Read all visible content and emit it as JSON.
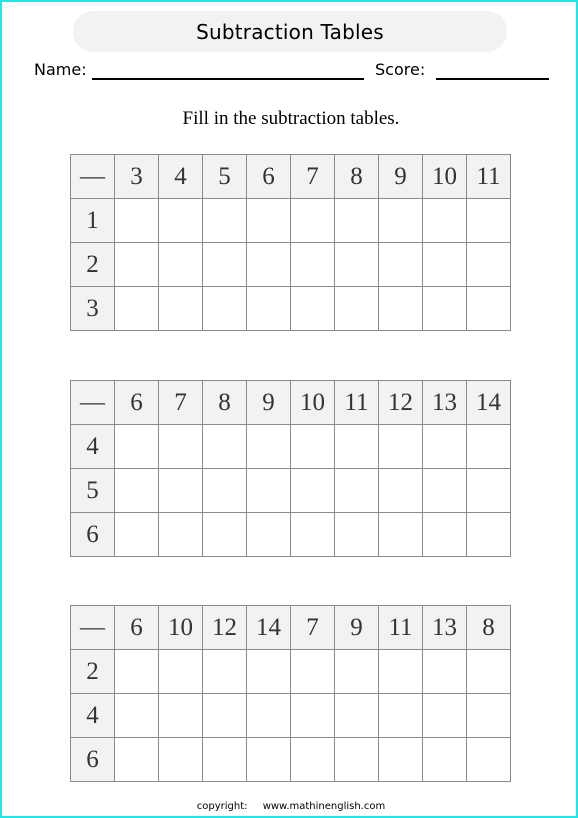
{
  "header": {
    "title": "Subtraction Tables",
    "name_label": "Name:",
    "score_label": "Score:"
  },
  "instructions": "Fill in the subtraction tables.",
  "tables": [
    {
      "operator": "—",
      "columns": [
        "3",
        "4",
        "5",
        "6",
        "7",
        "8",
        "9",
        "10",
        "11"
      ],
      "rows": [
        "1",
        "2",
        "3"
      ]
    },
    {
      "operator": "—",
      "columns": [
        "6",
        "7",
        "8",
        "9",
        "10",
        "11",
        "12",
        "13",
        "14"
      ],
      "rows": [
        "4",
        "5",
        "6"
      ]
    },
    {
      "operator": "—",
      "columns": [
        "6",
        "10",
        "12",
        "14",
        "7",
        "9",
        "11",
        "13",
        "8"
      ],
      "rows": [
        "2",
        "4",
        "6"
      ]
    }
  ],
  "footer": {
    "copyright_label": "copyright:",
    "website": "www.mathinenglish.com"
  },
  "colors": {
    "page_border": "#22e6e6",
    "header_fill": "#f2f2f2",
    "grid_line": "#8a8a8a"
  }
}
